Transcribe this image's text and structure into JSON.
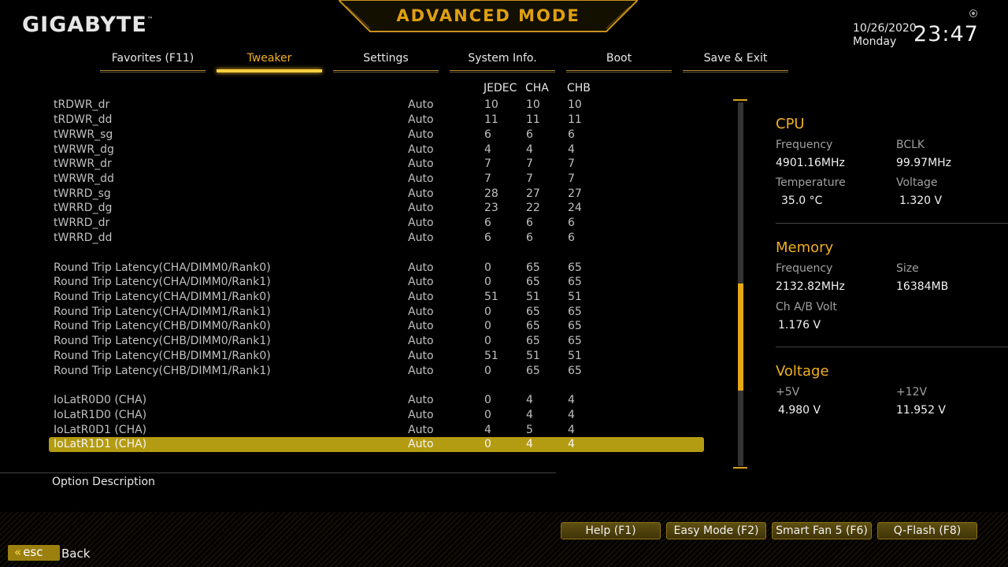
{
  "brand": "GIGABYTE",
  "mode_title": "ADVANCED MODE",
  "datetime": {
    "date": "10/26/2020",
    "day": "Monday",
    "time": "23:47"
  },
  "tabs": [
    {
      "label": "Favorites (F11)"
    },
    {
      "label": "Tweaker",
      "active": true
    },
    {
      "label": "Settings"
    },
    {
      "label": "System Info."
    },
    {
      "label": "Boot"
    },
    {
      "label": "Save & Exit"
    }
  ],
  "table": {
    "columns": [
      "JEDEC",
      "CHA",
      "CHB"
    ],
    "rows": [
      {
        "name": "tRDWR_dr",
        "value": "Auto",
        "jedec": "10",
        "cha": "10",
        "chb": "10"
      },
      {
        "name": "tRDWR_dd",
        "value": "Auto",
        "jedec": "11",
        "cha": "11",
        "chb": "11"
      },
      {
        "name": "tWRWR_sg",
        "value": "Auto",
        "jedec": "6",
        "cha": "6",
        "chb": "6"
      },
      {
        "name": "tWRWR_dg",
        "value": "Auto",
        "jedec": "4",
        "cha": "4",
        "chb": "4"
      },
      {
        "name": "tWRWR_dr",
        "value": "Auto",
        "jedec": "7",
        "cha": "7",
        "chb": "7"
      },
      {
        "name": "tWRWR_dd",
        "value": "Auto",
        "jedec": "7",
        "cha": "7",
        "chb": "7"
      },
      {
        "name": "tWRRD_sg",
        "value": "Auto",
        "jedec": "28",
        "cha": "27",
        "chb": "27"
      },
      {
        "name": "tWRRD_dg",
        "value": "Auto",
        "jedec": "23",
        "cha": "22",
        "chb": "24"
      },
      {
        "name": "tWRRD_dr",
        "value": "Auto",
        "jedec": "6",
        "cha": "6",
        "chb": "6"
      },
      {
        "name": "tWRRD_dd",
        "value": "Auto",
        "jedec": "6",
        "cha": "6",
        "chb": "6"
      },
      {
        "name": "Round Trip Latency(CHA/DIMM0/Rank0)",
        "value": "Auto",
        "jedec": "0",
        "cha": "65",
        "chb": "65"
      },
      {
        "name": "Round Trip Latency(CHA/DIMM0/Rank1)",
        "value": "Auto",
        "jedec": "0",
        "cha": "65",
        "chb": "65"
      },
      {
        "name": "Round Trip Latency(CHA/DIMM1/Rank0)",
        "value": "Auto",
        "jedec": "51",
        "cha": "51",
        "chb": "51"
      },
      {
        "name": "Round Trip Latency(CHA/DIMM1/Rank1)",
        "value": "Auto",
        "jedec": "0",
        "cha": "65",
        "chb": "65"
      },
      {
        "name": "Round Trip Latency(CHB/DIMM0/Rank0)",
        "value": "Auto",
        "jedec": "0",
        "cha": "65",
        "chb": "65"
      },
      {
        "name": "Round Trip Latency(CHB/DIMM0/Rank1)",
        "value": "Auto",
        "jedec": "0",
        "cha": "65",
        "chb": "65"
      },
      {
        "name": "Round Trip Latency(CHB/DIMM1/Rank0)",
        "value": "Auto",
        "jedec": "51",
        "cha": "51",
        "chb": "51"
      },
      {
        "name": "Round Trip Latency(CHB/DIMM1/Rank1)",
        "value": "Auto",
        "jedec": "0",
        "cha": "65",
        "chb": "65"
      },
      {
        "name": "IoLatR0D0 (CHA)",
        "value": "Auto",
        "jedec": "0",
        "cha": "4",
        "chb": "4"
      },
      {
        "name": "IoLatR1D0 (CHA)",
        "value": "Auto",
        "jedec": "0",
        "cha": "4",
        "chb": "4"
      },
      {
        "name": "IoLatR0D1 (CHA)",
        "value": "Auto",
        "jedec": "4",
        "cha": "5",
        "chb": "4"
      },
      {
        "name": "IoLatR1D1 (CHA)",
        "value": "Auto",
        "jedec": "0",
        "cha": "4",
        "chb": "4",
        "selected": true
      }
    ]
  },
  "panel": {
    "cpu": {
      "title": "CPU",
      "frequency_label": "Frequency",
      "frequency": "4901.16MHz",
      "bclk_label": "BCLK",
      "bclk": "99.97MHz",
      "temperature_label": "Temperature",
      "temperature": "35.0 °C",
      "voltage_label": "Voltage",
      "voltage": "1.320 V"
    },
    "memory": {
      "title": "Memory",
      "frequency_label": "Frequency",
      "frequency": "2132.82MHz",
      "size_label": "Size",
      "size": "16384MB",
      "volt_label": "Ch A/B Volt",
      "volt": "1.176 V"
    },
    "voltage": {
      "title": "Voltage",
      "v5_label": "+5V",
      "v5": "4.980 V",
      "v12_label": "+12V",
      "v12": "11.952 V"
    }
  },
  "description_label": "Option Description",
  "buttons": {
    "help": "Help (F1)",
    "easy": "Easy Mode (F2)",
    "smartfan": "Smart Fan 5 (F6)",
    "qflash": "Q-Flash (F8)"
  },
  "esc": {
    "key": "esc",
    "label": "Back"
  },
  "colors": {
    "accent": "#f0b020",
    "selected_row": "#b39b12",
    "scroll_thumb": "#e6a817"
  }
}
